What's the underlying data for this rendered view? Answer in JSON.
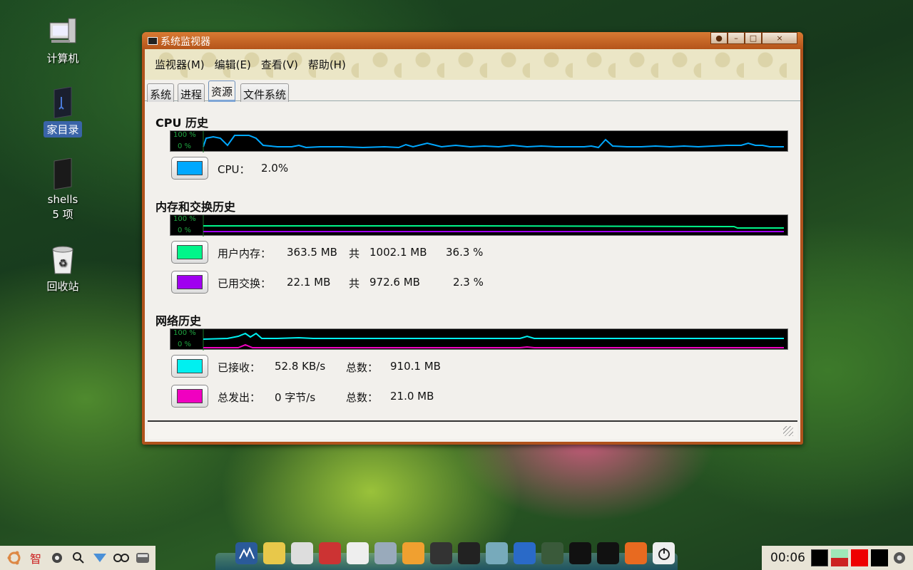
{
  "desktop": {
    "icons": [
      {
        "label": "计算机"
      },
      {
        "label": "家目录"
      },
      {
        "label": "shells",
        "sublabel": "5 项"
      },
      {
        "label": "回收站"
      }
    ]
  },
  "window": {
    "title": "系统监视器",
    "controls": [
      "●",
      "–",
      "□",
      "×"
    ]
  },
  "menubar": {
    "items": [
      "监视器(M)",
      "编辑(E)",
      "查看(V)",
      "帮助(H)"
    ]
  },
  "tabs": {
    "items": [
      "系统",
      "进程",
      "资源",
      "文件系统"
    ],
    "active": "资源"
  },
  "graph_ticks": {
    "top": "100 %",
    "bottom": "0 %"
  },
  "cpu": {
    "title": "CPU 历史",
    "label": "CPU：",
    "value": "2.0%",
    "color": "#00a8ff"
  },
  "memory": {
    "title": "内存和交换历史",
    "user_label": "用户内存：",
    "user_used": "363.5 MB",
    "user_of": "共",
    "user_total": "1002.1 MB",
    "user_percent": "36.3 %",
    "user_color": "#00f58a",
    "swap_label": "已用交换：",
    "swap_used": "22.1 MB",
    "swap_of": "共",
    "swap_total": "972.6 MB",
    "swap_percent": "2.3 %",
    "swap_color": "#a000f0"
  },
  "network": {
    "title": "网络历史",
    "recv_label": "已接收：",
    "recv_rate": "52.8 KB/s",
    "recv_total_label": "总数：",
    "recv_total": "910.1 MB",
    "recv_color": "#00f0f0",
    "sent_label": "总发出：",
    "sent_rate": "0 字节/s",
    "sent_total_label": "总数：",
    "sent_total": "21.0 MB",
    "sent_color": "#f000c0"
  },
  "taskbar": {
    "left_char": "智",
    "clock": "00:06"
  }
}
